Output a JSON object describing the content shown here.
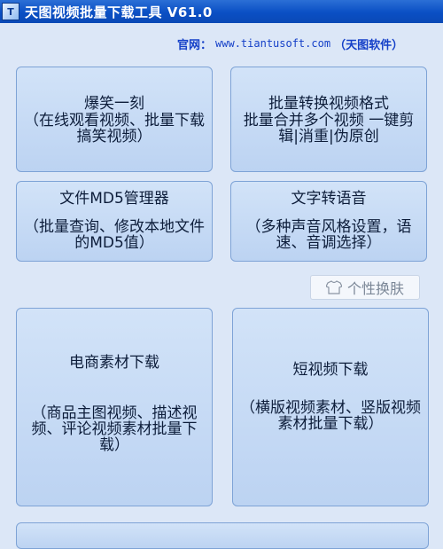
{
  "window": {
    "icon_text": "T",
    "title": "天图视频批量下载工具 V61.0"
  },
  "site": {
    "prefix": "官网：",
    "url": "www.tiantusoft.com",
    "suffix": "（天图软件）"
  },
  "cards": [
    {
      "title": "爆笑一刻",
      "desc": "（在线观看视频、批量下载搞笑视频）"
    },
    {
      "title": "批量转换视频格式",
      "desc": "批量合并多个视频 一键剪辑|消重|伪原创"
    },
    {
      "title": "文件MD5管理器",
      "desc": "（批量查询、修改本地文件的MD5值）"
    },
    {
      "title": "文字转语音",
      "desc": "（多种声音风格设置，语速、音调选择）"
    },
    {
      "title": "电商素材下载",
      "desc": "（商品主图视频、描述视频、评论视频素材批量下载）"
    },
    {
      "title": "短视频下载",
      "desc": "（横版视频素材、竖版视频素材批量下载）"
    }
  ],
  "skin": {
    "label": "个性换肤",
    "icon": "shirt-icon"
  },
  "colors": {
    "titlebar": "#0a4fc4",
    "background": "#dce7f7",
    "card": "#c6daf5",
    "link": "#1540c8"
  }
}
